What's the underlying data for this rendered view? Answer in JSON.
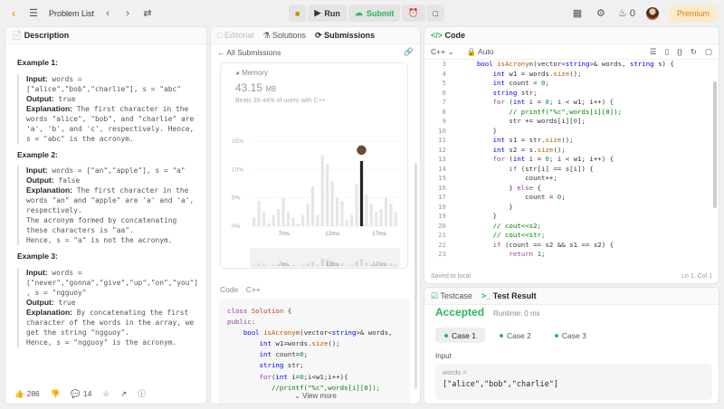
{
  "topbar": {
    "problem_list": "Problem List",
    "run": "Run",
    "submit": "Submit",
    "coins": "0",
    "premium": "Premium"
  },
  "description_panel": {
    "tab": "Description",
    "examples": [
      {
        "title": "Example 1:",
        "lines": [
          {
            "label": "Input:",
            "text": " words ="
          },
          {
            "label": "",
            "text": "[\"alice\",\"bob\",\"charlie\"], s = \"abc\""
          },
          {
            "label": "Output:",
            "text": " true"
          },
          {
            "label": "Explanation:",
            "text": " The first character in the"
          },
          {
            "label": "",
            "text": "words \"alice\", \"bob\", and \"charlie\" are"
          },
          {
            "label": "",
            "text": "'a', 'b', and 'c', respectively. Hence,"
          },
          {
            "label": "",
            "text": "s = \"abc\" is the acronym."
          }
        ]
      },
      {
        "title": "Example 2:",
        "lines": [
          {
            "label": "Input:",
            "text": " words = [\"an\",\"apple\"], s = \"a\""
          },
          {
            "label": "Output:",
            "text": " false"
          },
          {
            "label": "Explanation:",
            "text": " The first character in the"
          },
          {
            "label": "",
            "text": "words \"an\" and \"apple\" are 'a' and 'a',"
          },
          {
            "label": "",
            "text": "respectively."
          },
          {
            "label": "",
            "text": "The acronym formed by concatenating"
          },
          {
            "label": "",
            "text": "these characters is \"aa\"."
          },
          {
            "label": "",
            "text": "Hence, s = \"a\" is not the acronym."
          }
        ]
      },
      {
        "title": "Example 3:",
        "lines": [
          {
            "label": "Input:",
            "text": " words ="
          },
          {
            "label": "",
            "text": "[\"never\",\"gonna\",\"give\",\"up\",\"on\",\"you\"]"
          },
          {
            "label": "",
            "text": ", s = \"ngguoy\""
          },
          {
            "label": "Output:",
            "text": " true"
          },
          {
            "label": "Explanation:",
            "text": " By concatenating the first"
          },
          {
            "label": "",
            "text": "character of the words in the array, we"
          },
          {
            "label": "",
            "text": "get the string \"ngguoy\"."
          },
          {
            "label": "",
            "text": "Hence, s = \"ngguoy\" is the acronym."
          }
        ]
      }
    ],
    "likes": "286",
    "comments": "14"
  },
  "submissions_panel": {
    "tabs": [
      "Editorial",
      "Solutions",
      "Submissions"
    ],
    "back": "All Submissions",
    "memory_label": "Memory",
    "memory_value": "43.15",
    "memory_unit": "MB",
    "beats": "Beats 39.44% of users with C++",
    "chart_data": {
      "type": "bar",
      "ylabels": [
        "15%",
        "10%",
        "5%",
        "0%"
      ],
      "xlabels": [
        "7ms",
        "12ms",
        "17ms"
      ],
      "values": [
        1.5,
        4.5,
        2.5,
        0.5,
        2,
        3,
        5,
        2.5,
        1.5,
        0.5,
        2,
        4,
        7,
        2,
        12.5,
        11,
        8,
        5,
        4.5,
        1,
        2,
        7.5,
        11.5,
        5.5,
        4,
        2.5,
        3,
        5,
        4,
        2.5
      ],
      "highlight_index": 22,
      "ylim": [
        0,
        15
      ]
    },
    "code_lang_label": "Code",
    "code_lang": "C++",
    "view_more": "View more"
  },
  "code_panel": {
    "tab": "Code",
    "lang": "C++",
    "auto": "Auto",
    "saved": "Saved to local",
    "cursor": "Ln 1, Col 1",
    "first_line": 3
  },
  "result_panel": {
    "tab_testcase": "Testcase",
    "tab_result": "Test Result",
    "status": "Accepted",
    "runtime": "Runtime: 0 ms",
    "cases": [
      "Case 1",
      "Case 2",
      "Case 3"
    ],
    "input_label": "Input",
    "var_label": "words =",
    "var_value": "[\"alice\",\"bob\",\"charlie\"]"
  }
}
